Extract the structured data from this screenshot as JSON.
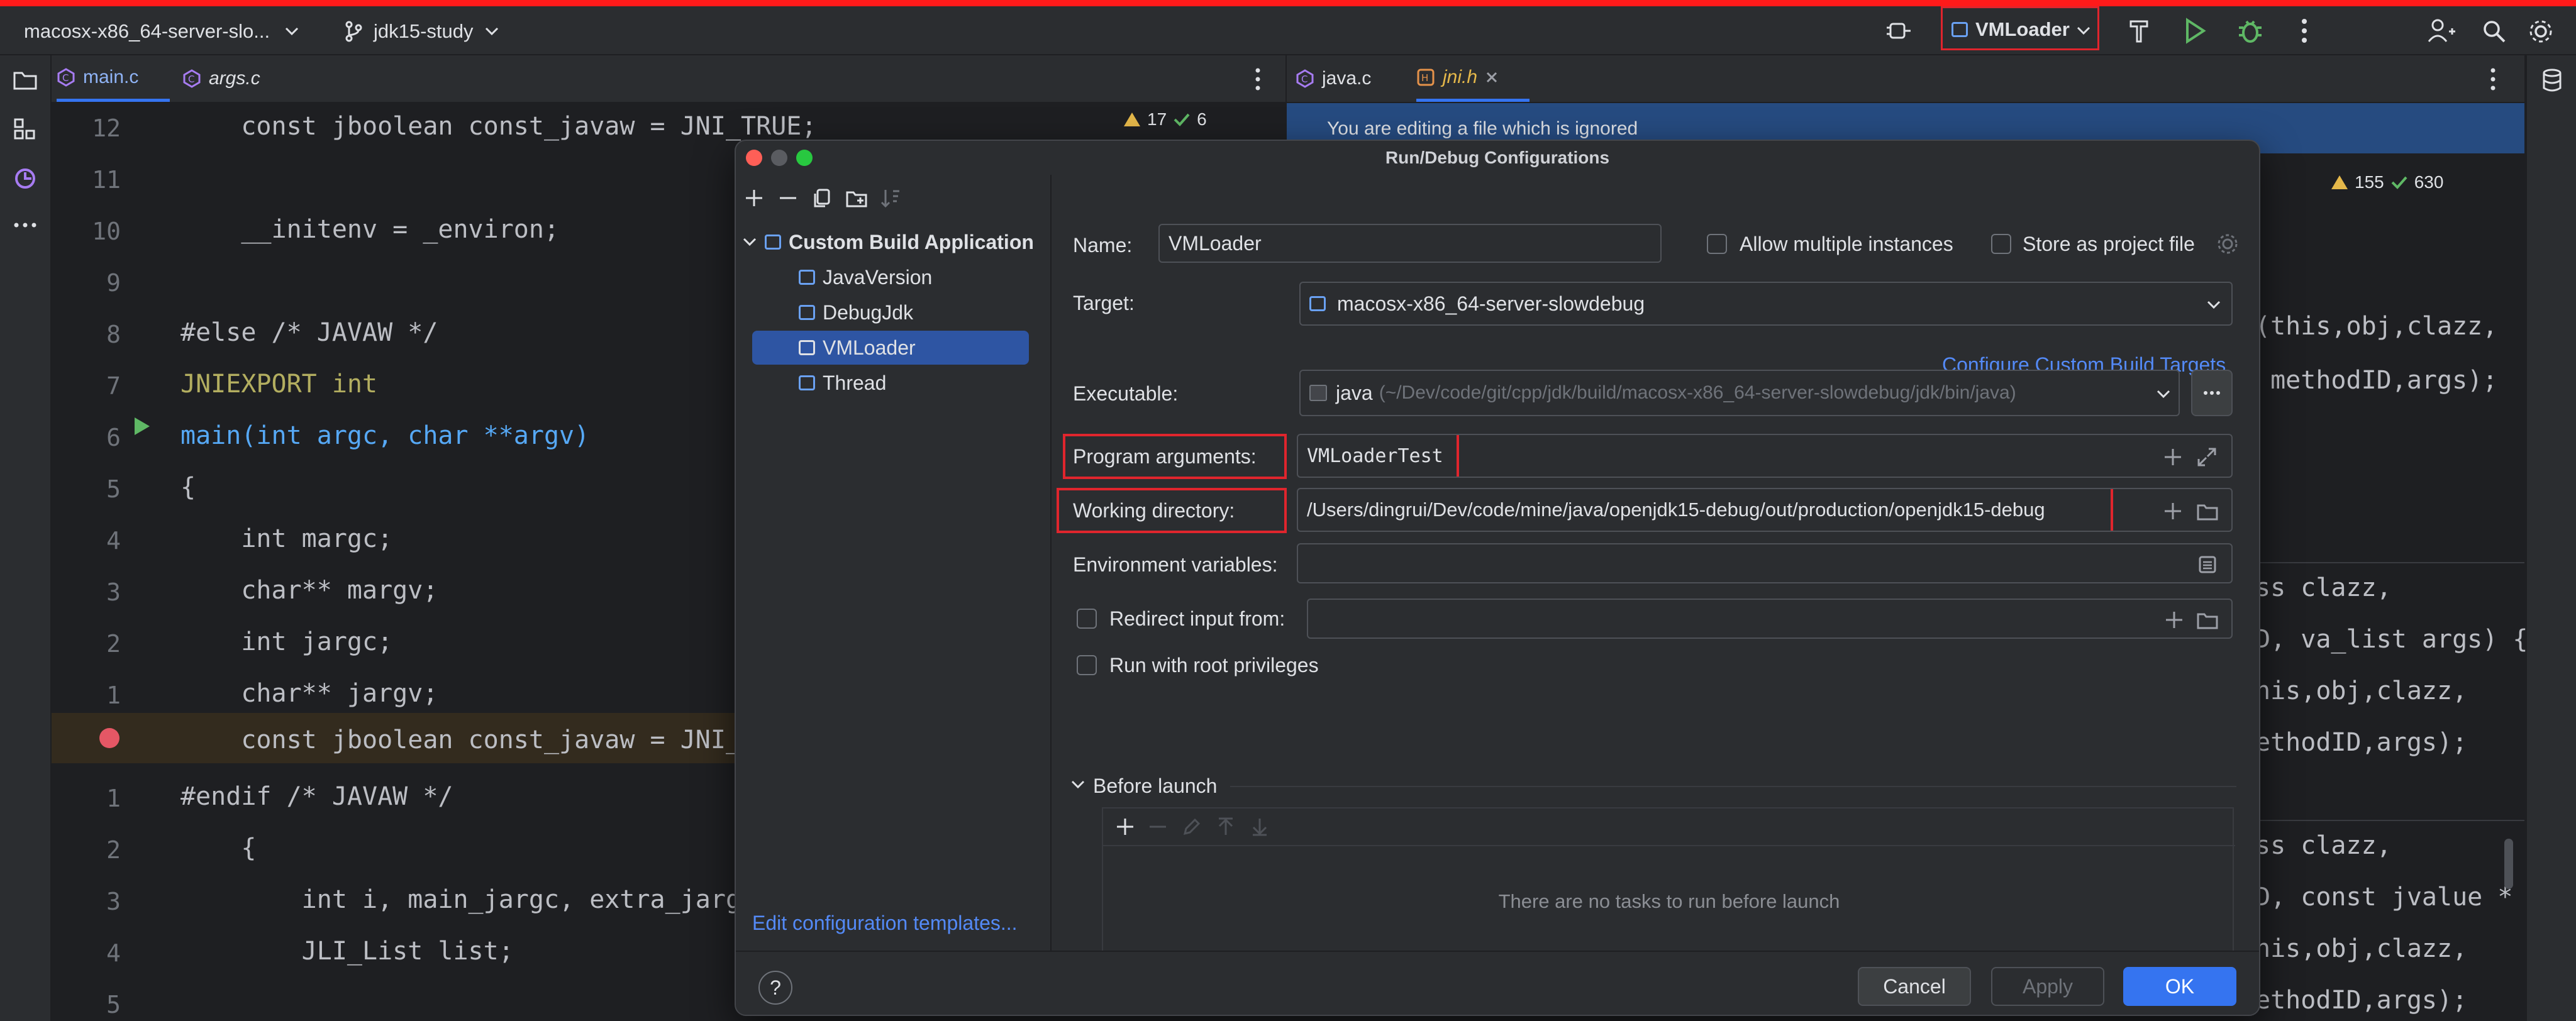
{
  "titlebar": {
    "project": "macosx-x86_64-server-slo...",
    "branch": "jdk15-study",
    "run_config": "VMLoader"
  },
  "left_editor": {
    "tabs": [
      {
        "label": "main.c",
        "active": true
      },
      {
        "label": "args.c",
        "active": false
      }
    ],
    "inspections": {
      "warnings": "17",
      "ok": "6"
    },
    "lines": [
      {
        "num": "12",
        "code": "    const jboolean const_javaw = JNI_TRUE;"
      },
      {
        "num": "11",
        "code": ""
      },
      {
        "num": "10",
        "code": "    __initenv = _environ;"
      },
      {
        "num": "9",
        "code": ""
      },
      {
        "num": "8",
        "code": "#else /* JAVAW */"
      },
      {
        "num": "7",
        "code": "JNIEXPORT int"
      },
      {
        "num": "6",
        "code": "main(int argc, char **argv)"
      },
      {
        "num": "5",
        "code": "{"
      },
      {
        "num": "4",
        "code": "    int margc;"
      },
      {
        "num": "3",
        "code": "    char** margv;"
      },
      {
        "num": "2",
        "code": "    int jargc;"
      },
      {
        "num": "1",
        "code": "    char** jargv;"
      },
      {
        "num": "",
        "code": "    const jboolean const_javaw = JNI_"
      },
      {
        "num": "1",
        "code": "#endif /* JAVAW */"
      },
      {
        "num": "2",
        "code": "    {"
      },
      {
        "num": "3",
        "code": "        int i, main_jargc, extra_jarg"
      },
      {
        "num": "4",
        "code": "        JLI_List list;"
      },
      {
        "num": "5",
        "code": ""
      }
    ]
  },
  "right_editor": {
    "tabs": [
      {
        "label": "java.c",
        "active": false
      },
      {
        "label": "jni.h",
        "active": true
      }
    ],
    "banner": "You are editing a file which is ignored",
    "inspections": {
      "warnings": "155",
      "ok": "630"
    },
    "fragments": [
      "(this,obj,clazz,",
      " methodID,args);",
      "ss clazz,",
      "D, va_list args) {",
      "his,obj,clazz,",
      "ethodID,args);",
      "ss clazz,",
      "D, const jvalue *",
      "his,obj,clazz,",
      "ethodID,args);"
    ]
  },
  "dialog": {
    "title": "Run/Debug Configurations",
    "tree": {
      "group": "Custom Build Application",
      "items": [
        "JavaVersion",
        "DebugJdk",
        "VMLoader",
        "Thread"
      ],
      "selected": "VMLoader"
    },
    "edit_templates": "Edit configuration templates...",
    "name_label": "Name:",
    "name_value": "VMLoader",
    "allow_multiple": "Allow multiple instances",
    "store_project": "Store as project file",
    "target_label": "Target:",
    "target_value": "macosx-x86_64-server-slowdebug",
    "configure_link": "Configure Custom Build Targets",
    "executable_label": "Executable:",
    "executable_name": "java",
    "executable_path": "(~/Dev/code/git/cpp/jdk/build/macosx-x86_64-server-slowdebug/jdk/bin/java)",
    "program_args_label": "Program arguments:",
    "program_args_value": "VMLoaderTest",
    "working_dir_label": "Working directory:",
    "working_dir_value": "/Users/dingrui/Dev/code/mine/java/openjdk15-debug/out/production/openjdk15-debug",
    "env_label": "Environment variables:",
    "redirect_label": "Redirect input from:",
    "root_label": "Run with root privileges",
    "before_launch": "Before launch",
    "no_tasks": "There are no tasks to run before launch",
    "cancel": "Cancel",
    "apply": "Apply",
    "ok": "OK",
    "help": "?"
  }
}
